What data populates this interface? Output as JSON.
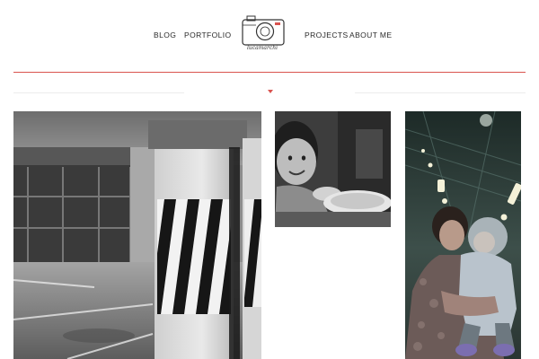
{
  "nav": {
    "blog": "BLOG",
    "portfolio": "PORTFOLIO",
    "projects": "PROJECTS",
    "about_me": "ABOUT ME"
  },
  "logo": {
    "text": "lucamarchi",
    "icon": "camera-icon"
  },
  "colors": {
    "accent": "#d9534f",
    "text": "#2a2a2a",
    "divider": "#ececec"
  },
  "gallery": {
    "items": [
      {
        "name": "parking-garage-pillar-photo"
      },
      {
        "name": "smiling-child-photo"
      },
      {
        "name": "woman-holding-baby-photo"
      }
    ]
  }
}
